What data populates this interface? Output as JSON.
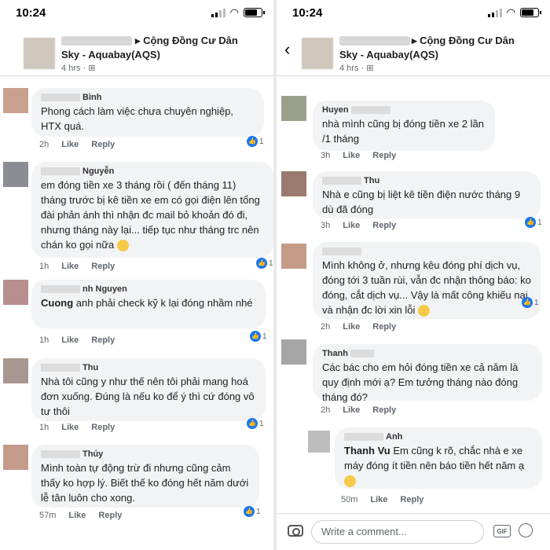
{
  "status": {
    "left_time": "10:24",
    "right_time": "10:24"
  },
  "header": {
    "group": "▸ Cộng Đồng Cư Dân",
    "name": "Sky - Aquabay(AQS)",
    "meta": "4 hrs · ⊞"
  },
  "actions": {
    "like": "Like",
    "reply": "Reply"
  },
  "left_comments": [
    {
      "author": "Bình",
      "text": "Phong cách làm việc chưa chuyên nghiệp, HTX quá.",
      "time": "2h",
      "count": "1"
    },
    {
      "author": "Nguyễn",
      "text": "em đóng tiền xe 3 tháng rồi ( đến tháng 11) tháng trước bị kê tiền xe em có gọi điện lên tổng đài phản ánh thì nhận đc mail bỏ khoản đó đi, nhưng tháng này lại... tiếp tục như tháng trc nên chán ko gọi nữa",
      "time": "1h",
      "count": "1"
    },
    {
      "author": "nh Nguyen",
      "lead": "Cuong",
      "text": "anh phải check kỹ k lại đóng nhầm nhé",
      "time": "1h",
      "count": "1"
    },
    {
      "author": "Thu",
      "text": "Nhà tôi cũng y như thế nên tôi phải mang hoá đơn xuống. Đúng là nếu ko để ý thì cứ đóng vô tư thôi",
      "time": "1h",
      "count": "1"
    },
    {
      "author": "Thủy",
      "text": "Mình toàn tự động trừ đi nhưng cũng cảm thấy ko hợp lý. Biết thế ko đóng hết năm dưới lễ tân luôn cho xong.",
      "time": "57m",
      "count": "1"
    }
  ],
  "right_comments": [
    {
      "author": "Huyen",
      "text": "nhà mình cũng bị đóng tiền xe 2 lần /1 tháng",
      "time": "3h",
      "count": ""
    },
    {
      "author": "Thu",
      "text": "Nhà e cũng bị liệt kê tiền điện nước tháng 9 dù đã đóng",
      "time": "3h",
      "count": "1"
    },
    {
      "author": "",
      "text": "Mình không ở, nhưng kêu đóng phí dịch vụ, đóng tới 3 tuần rùi, vẫn đc nhận thông báo: ko đóng, cắt dịch vụ... Vậy là mất công khiếu nại và nhận đc lời xin lỗi",
      "time": "2h",
      "count": "1"
    },
    {
      "author": "Thanh",
      "text": "Các bác cho em hỏi đóng tiền xe cả năm là quy định mới ạ? Em tưởng tháng nào đóng tháng đó?",
      "time": "2h",
      "count": ""
    },
    {
      "author": "Anh",
      "lead": "Thanh Vu",
      "text": "Em cũng k rõ, chắc nhà e xe máy đóng ít tiền nên báo tiền hết năm ạ",
      "time": "50m",
      "count": ""
    }
  ],
  "composer": {
    "placeholder": "Write a comment...",
    "gif": "GIF"
  },
  "colors": {
    "like_blue": "#1877f2",
    "bubble": "#f2f3f5"
  }
}
